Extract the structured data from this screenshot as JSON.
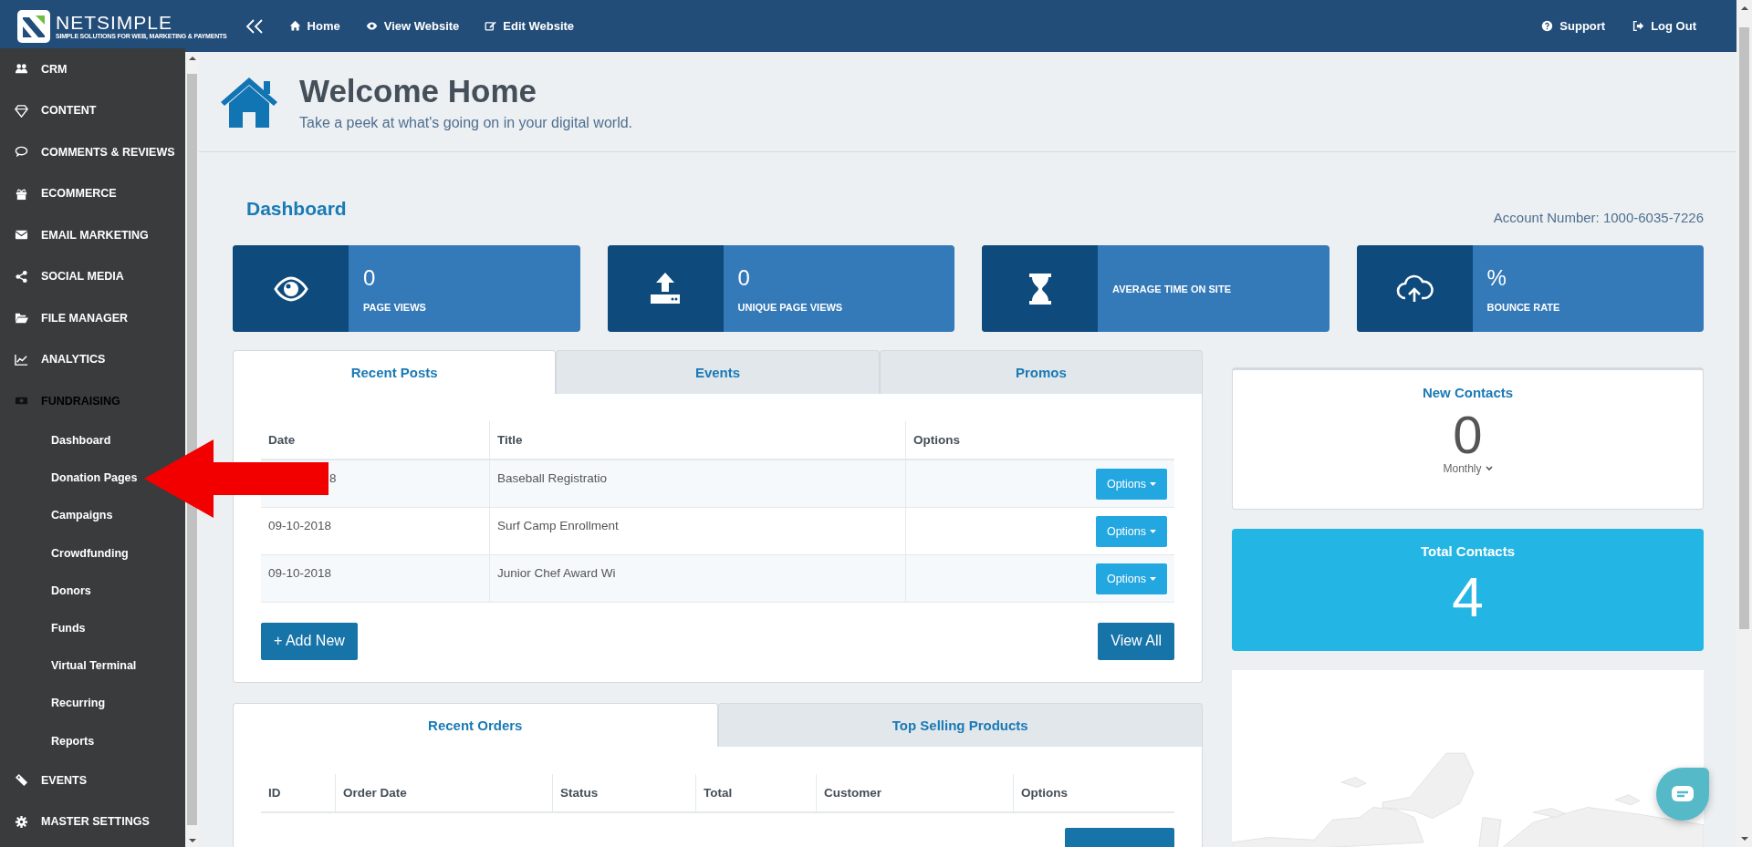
{
  "topbar": {
    "logo": {
      "name": "NETSIMPLE",
      "tagline": "SIMPLE SOLUTIONS FOR WEB, MARKETING & PAYMENTS"
    },
    "nav": [
      {
        "label": "Home"
      },
      {
        "label": "View Website"
      },
      {
        "label": "Edit Website"
      }
    ],
    "right": [
      {
        "label": "Support"
      },
      {
        "label": "Log Out"
      }
    ]
  },
  "sidebar": {
    "items": [
      {
        "label": "CRM",
        "expanded": false
      },
      {
        "label": "CONTENT",
        "expanded": false
      },
      {
        "label": "COMMENTS & REVIEWS",
        "expanded": false
      },
      {
        "label": "ECOMMERCE",
        "expanded": false
      },
      {
        "label": "EMAIL MARKETING",
        "expanded": false
      },
      {
        "label": "SOCIAL MEDIA",
        "expanded": false
      },
      {
        "label": "FILE MANAGER",
        "expanded": false
      },
      {
        "label": "ANALYTICS",
        "expanded": false
      },
      {
        "label": "FUNDRAISING",
        "expanded": true,
        "children": [
          {
            "label": "Dashboard"
          },
          {
            "label": "Donation Pages"
          },
          {
            "label": "Campaigns"
          },
          {
            "label": "Crowdfunding"
          },
          {
            "label": "Donors"
          },
          {
            "label": "Funds"
          },
          {
            "label": "Virtual Terminal"
          },
          {
            "label": "Recurring"
          },
          {
            "label": "Reports"
          }
        ]
      },
      {
        "label": "EVENTS",
        "expanded": false
      },
      {
        "label": "MASTER SETTINGS",
        "expanded": false
      }
    ]
  },
  "header": {
    "title": "Welcome Home",
    "subtitle": "Take a peek at what's going on in your digital world."
  },
  "dashboard": {
    "title": "Dashboard",
    "account": "Account Number: 1000-6035-7226",
    "stats": [
      {
        "value": "0",
        "label": "PAGE VIEWS"
      },
      {
        "value": "0",
        "label": "UNIQUE PAGE VIEWS"
      },
      {
        "label": "AVERAGE TIME ON SITE"
      },
      {
        "value": "%",
        "label": "BOUNCE RATE"
      }
    ]
  },
  "posts": {
    "tabs": [
      {
        "label": "Recent Posts",
        "selected": true
      },
      {
        "label": "Events",
        "selected": false
      },
      {
        "label": "Promos",
        "selected": false
      }
    ],
    "columns": [
      "Date",
      "Title",
      "Options"
    ],
    "rows": [
      {
        "date": "8",
        "title": "Baseball Registratio",
        "action": "Options"
      },
      {
        "date": "09-10-2018",
        "title": "Surf Camp Enrollment",
        "action": "Options"
      },
      {
        "date": "09-10-2018",
        "title": "Junior Chef Award Wi",
        "action": "Options"
      }
    ],
    "add_button": "+ Add New",
    "view_button": "View All"
  },
  "orders": {
    "tabs": [
      {
        "label": "Recent Orders",
        "selected": true
      },
      {
        "label": "Top Selling Products",
        "selected": false
      }
    ],
    "columns": [
      "ID",
      "Order Date",
      "Status",
      "Total",
      "Customer",
      "Options"
    ]
  },
  "new_contacts": {
    "title": "New Contacts",
    "value": "0",
    "period": "Monthly"
  },
  "total_contacts": {
    "title": "Total Contacts",
    "value": "4"
  }
}
